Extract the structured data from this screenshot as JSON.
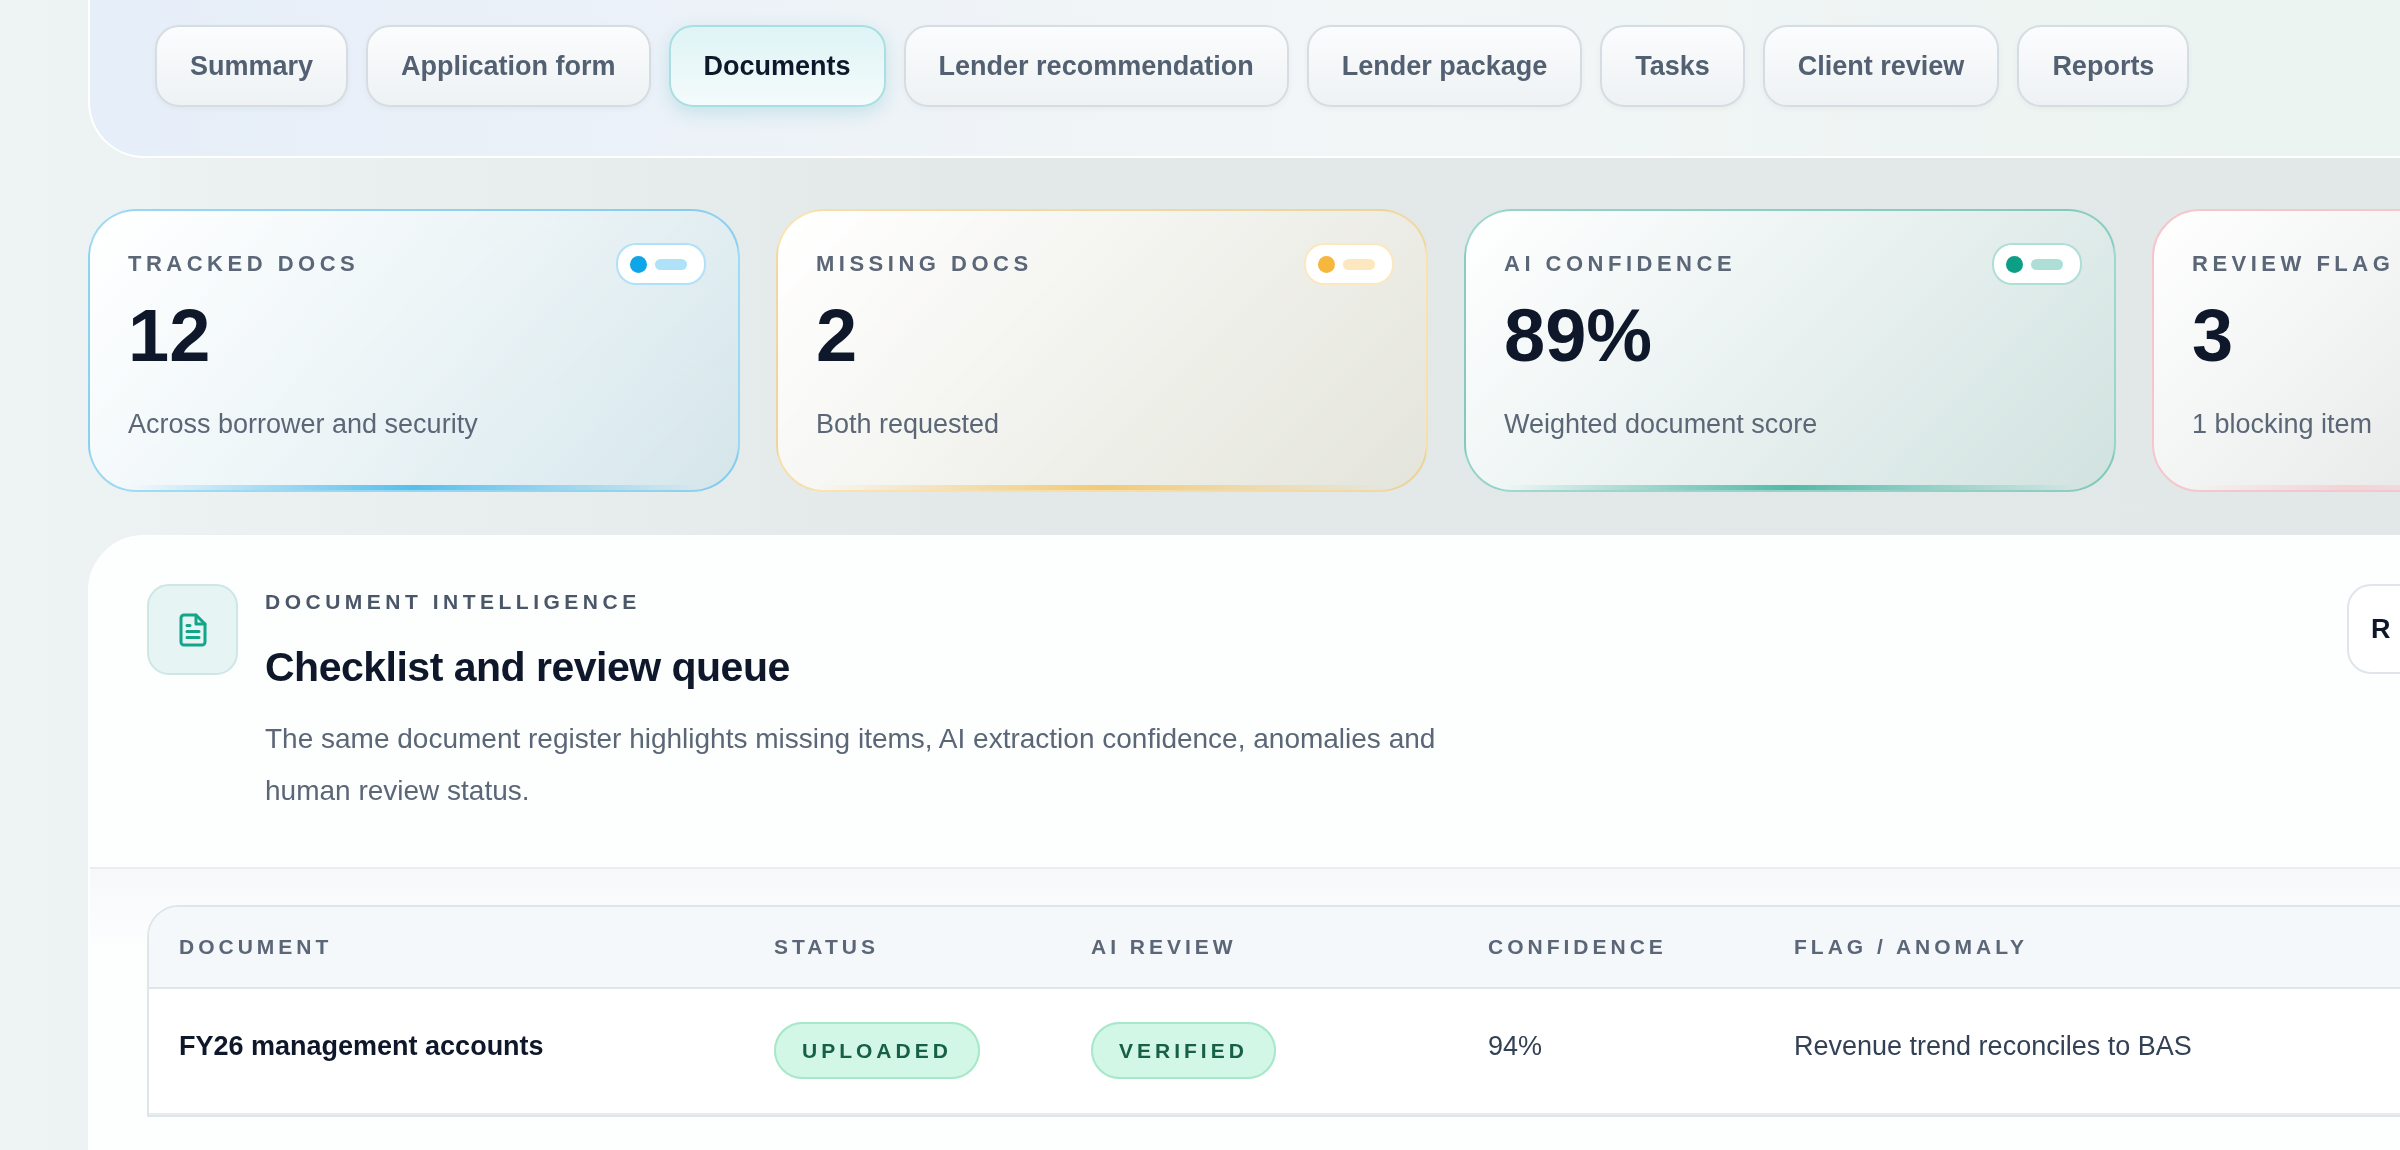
{
  "tabs": [
    {
      "label": "Summary",
      "selected": false
    },
    {
      "label": "Application form",
      "selected": false
    },
    {
      "label": "Documents",
      "selected": true
    },
    {
      "label": "Lender recommendation",
      "selected": false
    },
    {
      "label": "Lender package",
      "selected": false
    },
    {
      "label": "Tasks",
      "selected": false
    },
    {
      "label": "Client review",
      "selected": false
    },
    {
      "label": "Reports",
      "selected": false
    }
  ],
  "stat_cards": [
    {
      "label": "TRACKED DOCS",
      "value": "12",
      "caption": "Across borrower and security",
      "color": "#0ea5e9"
    },
    {
      "label": "MISSING DOCS",
      "value": "2",
      "caption": "Both requested",
      "color": "#f5b83d"
    },
    {
      "label": "AI CONFIDENCE",
      "value": "89%",
      "caption": "Weighted document score",
      "color": "#0d9f86"
    },
    {
      "label": "REVIEW FLAG",
      "value": "3",
      "caption": "1 blocking item",
      "color": "#f7c5cc"
    }
  ],
  "section": {
    "eyebrow": "DOCUMENT INTELLIGENCE",
    "title": "Checklist and review queue",
    "description": "The same document register highlights missing items, AI extraction confidence, anomalies and human review status.",
    "action_button": "R"
  },
  "table": {
    "columns": [
      "DOCUMENT",
      "STATUS",
      "AI REVIEW",
      "CONFIDENCE",
      "FLAG / ANOMALY"
    ],
    "rows": [
      {
        "document": "FY26 management accounts",
        "status": "UPLOADED",
        "ai_review": "VERIFIED",
        "confidence": "94%",
        "flag": "Revenue trend reconciles to BAS"
      }
    ]
  }
}
